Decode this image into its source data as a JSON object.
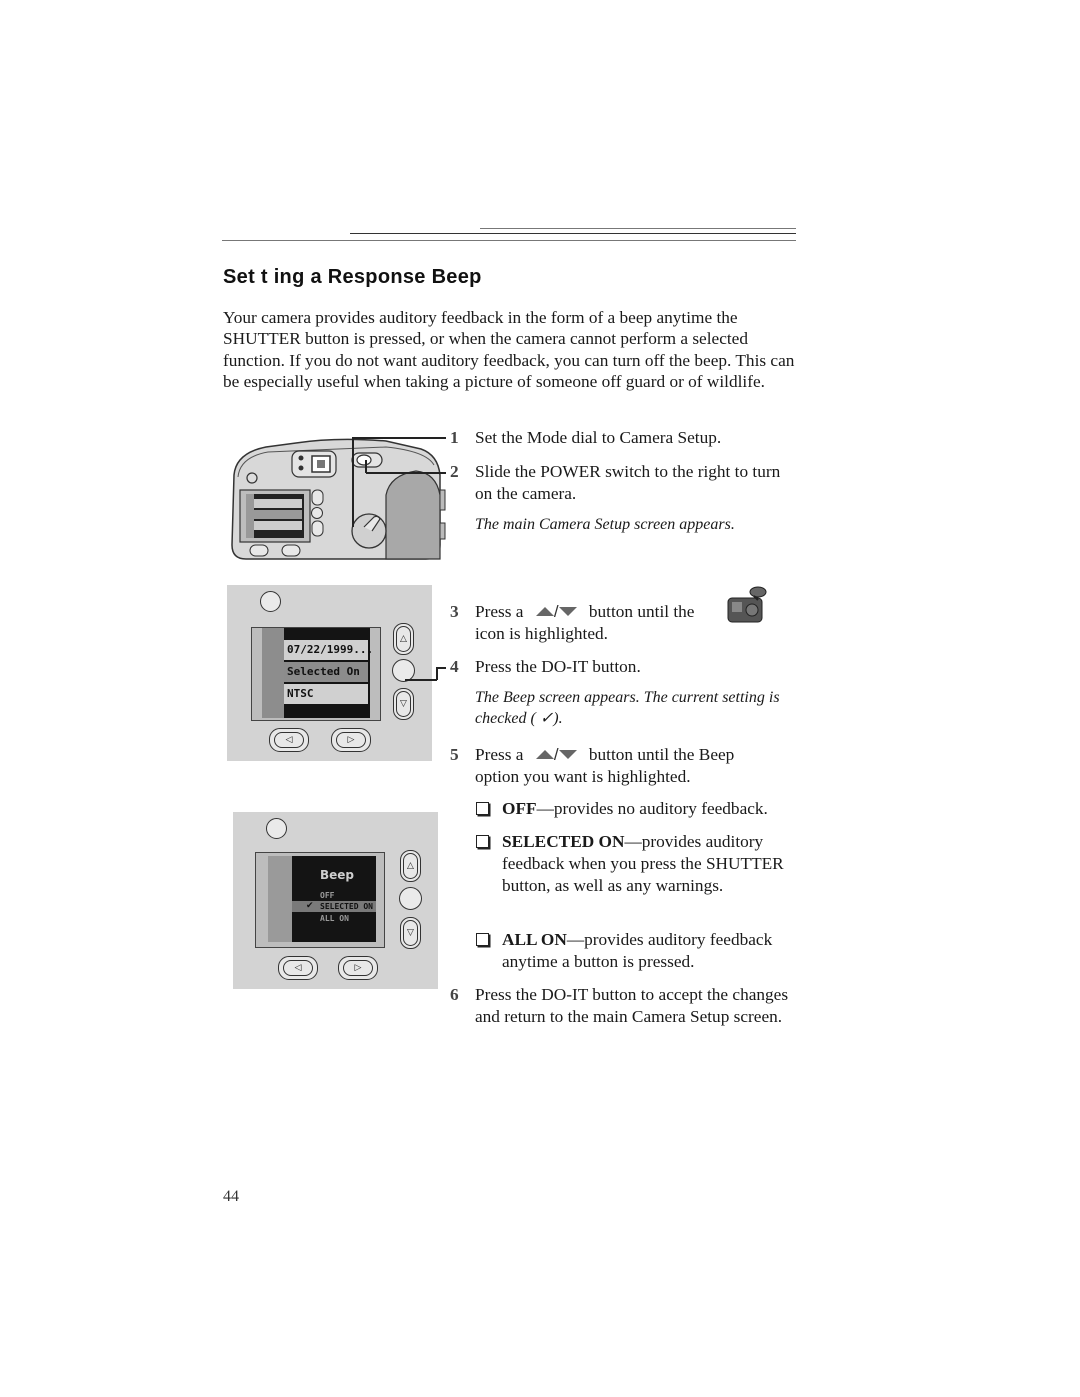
{
  "page": {
    "heading": "Set t ing a Response Beep",
    "intro": "Your camera provides auditory feedback in the form of a beep anytime the SHUTTER button is pressed, or when the camera cannot perform a selected function. If you do not want auditory feedback, you can turn off the beep. This can be especially useful when taking a picture of someone off guard or of wildlife.",
    "page_number": "44"
  },
  "steps": [
    {
      "num": "1",
      "text": "Set the Mode dial to Camera Setup."
    },
    {
      "num": "2",
      "text": "Slide the POWER switch to the right to turn on the camera."
    },
    {
      "num": "3",
      "text_before": "Press a",
      "text_after": "button until the",
      "text_line2": "icon is highlighted."
    },
    {
      "num": "4",
      "text": "Press the DO-IT button."
    },
    {
      "num": "5",
      "text_before": "Press a",
      "text_after": "button until the Beep",
      "text_line2": "option you want is highlighted."
    },
    {
      "num": "6",
      "text": "Press the DO-IT button to accept the changes and return to the main Camera Setup screen."
    }
  ],
  "notes": {
    "after_step2": "The main Camera Setup screen appears.",
    "after_step4": "The Beep screen appears. The current setting is checked ( ✓)."
  },
  "options": [
    {
      "label": "OFF",
      "desc": "—provides no auditory feedback."
    },
    {
      "label": "SELECTED ON",
      "desc": "—provides auditory feedback when you press the SHUTTER button, as well as any warnings."
    },
    {
      "label": "ALL ON",
      "desc": "—provides auditory feedback anytime a button is pressed."
    }
  ],
  "camera_screen_main": {
    "rows": [
      "07/22/1999...",
      "Selected On",
      "NTSC"
    ],
    "highlighted_row": 1
  },
  "camera_screen_beep": {
    "title": "Beep",
    "options": [
      "OFF",
      "SELECTED ON",
      "ALL ON"
    ],
    "checked_option": "SELECTED ON",
    "check_mark": "✔"
  },
  "icons": {
    "up_arrow": "△",
    "down_arrow": "▽",
    "left_arrow": "◁",
    "right_arrow": "▷"
  }
}
